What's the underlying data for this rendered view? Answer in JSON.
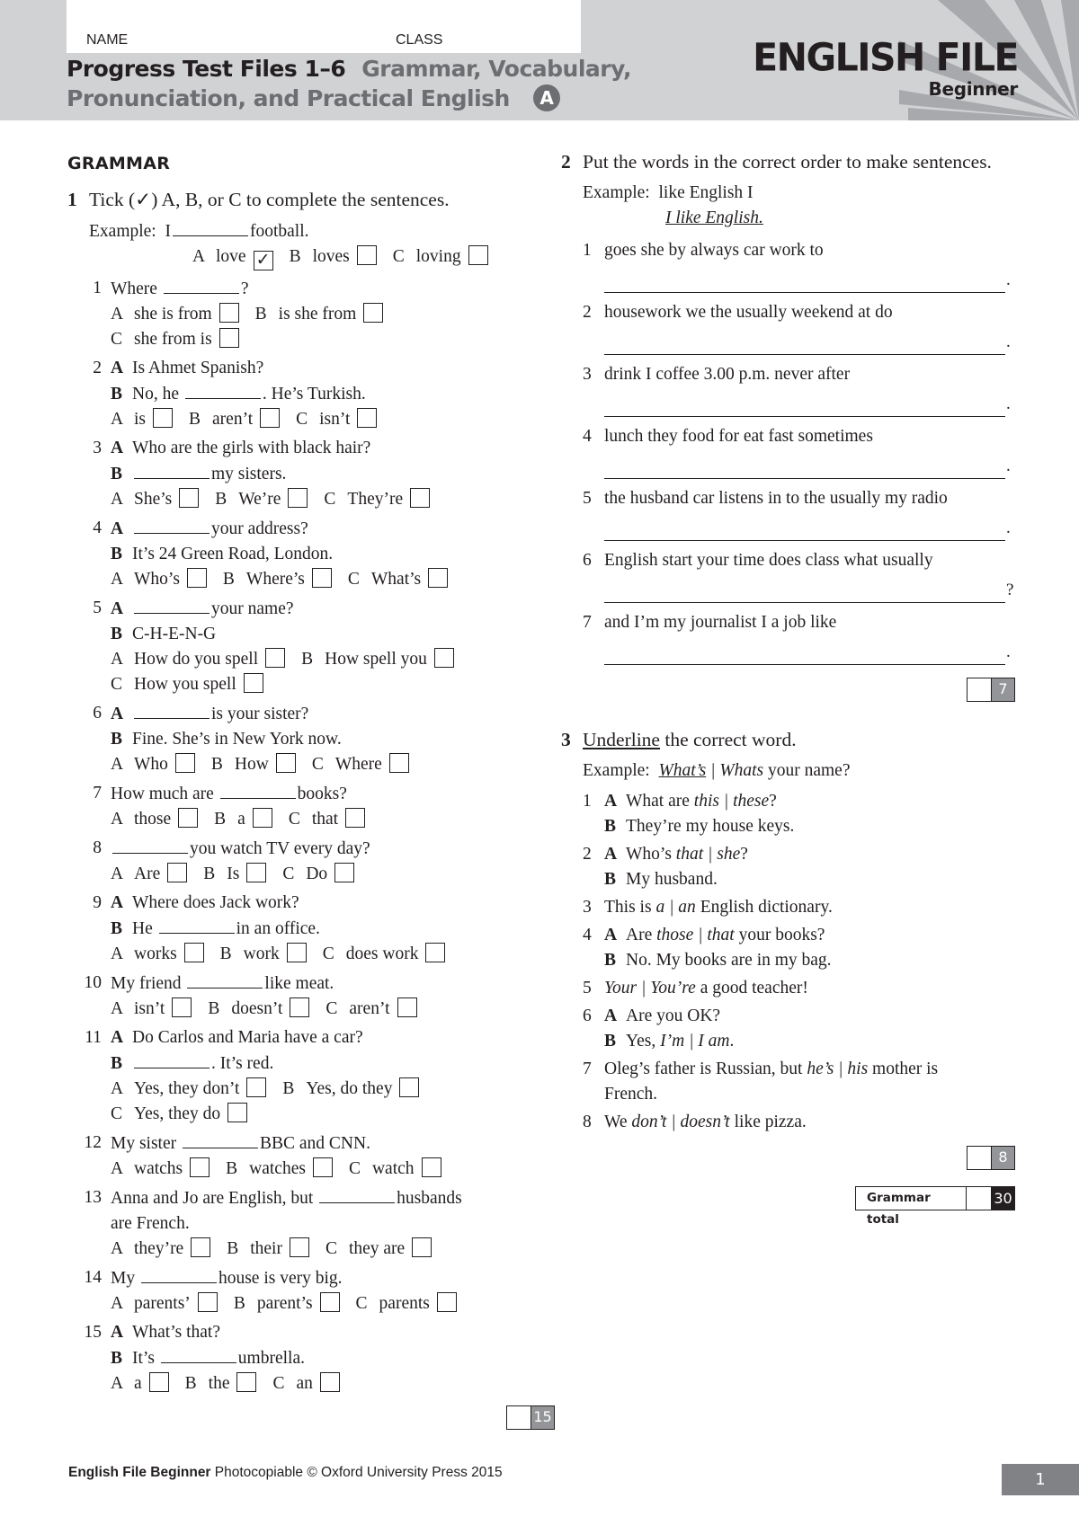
{
  "header": {
    "name_label": "NAME",
    "class_label": "CLASS",
    "title_dark": "Progress Test  Files 1–6",
    "title_grey_1": "Grammar, Vocabulary,",
    "title_grey_2": "Pronunciation, and Practical English",
    "version": "A",
    "brand_title": "ENGLISH FILE",
    "brand_level": "Beginner"
  },
  "grammar": {
    "heading": "GRAMMAR",
    "ex1": {
      "number": "1",
      "instruction": "Tick (✓) A, B, or C to complete the sentences.",
      "example": {
        "label": "Example:",
        "before": "I",
        "after": "football.",
        "options": [
          {
            "letter": "A",
            "text": "love",
            "checked": "✓"
          },
          {
            "letter": "B",
            "text": "loves",
            "checked": ""
          },
          {
            "letter": "C",
            "text": "loving",
            "checked": ""
          }
        ]
      },
      "questions": [
        {
          "num": "1",
          "lines": [
            {
              "spk": "",
              "before": "Where",
              "blank": true,
              "after": "?"
            }
          ],
          "option_rows": [
            [
              {
                "letter": "A",
                "text": "she is from"
              },
              {
                "letter": "B",
                "text": "is she from"
              }
            ],
            [
              {
                "letter": "C",
                "text": "she from is"
              }
            ]
          ]
        },
        {
          "num": "2",
          "lines": [
            {
              "spk": "A",
              "before": "Is Ahmet Spanish?",
              "blank": false,
              "after": ""
            },
            {
              "spk": "B",
              "before": "No, he",
              "blank": true,
              "after": ". He’s Turkish."
            }
          ],
          "option_rows": [
            [
              {
                "letter": "A",
                "text": "is"
              },
              {
                "letter": "B",
                "text": "aren’t"
              },
              {
                "letter": "C",
                "text": "isn’t"
              }
            ]
          ]
        },
        {
          "num": "3",
          "lines": [
            {
              "spk": "A",
              "before": "Who are the girls with black hair?",
              "blank": false,
              "after": ""
            },
            {
              "spk": "B",
              "before": "",
              "blank": true,
              "after": "my sisters."
            }
          ],
          "option_rows": [
            [
              {
                "letter": "A",
                "text": "She’s"
              },
              {
                "letter": "B",
                "text": "We’re"
              },
              {
                "letter": "C",
                "text": "They’re"
              }
            ]
          ]
        },
        {
          "num": "4",
          "lines": [
            {
              "spk": "A",
              "before": "",
              "blank": true,
              "after": "your address?"
            },
            {
              "spk": "B",
              "before": "It’s 24 Green Road, London.",
              "blank": false,
              "after": ""
            }
          ],
          "option_rows": [
            [
              {
                "letter": "A",
                "text": "Who’s"
              },
              {
                "letter": "B",
                "text": "Where’s"
              },
              {
                "letter": "C",
                "text": "What’s"
              }
            ]
          ]
        },
        {
          "num": "5",
          "lines": [
            {
              "spk": "A",
              "before": "",
              "blank": true,
              "after": "your name?"
            },
            {
              "spk": "B",
              "before": "C-H-E-N-G",
              "blank": false,
              "after": ""
            }
          ],
          "option_rows": [
            [
              {
                "letter": "A",
                "text": "How do you spell"
              },
              {
                "letter": "B",
                "text": "How spell you"
              }
            ],
            [
              {
                "letter": "C",
                "text": "How you spell"
              }
            ]
          ]
        },
        {
          "num": "6",
          "lines": [
            {
              "spk": "A",
              "before": "",
              "blank": true,
              "after": "is your sister?"
            },
            {
              "spk": "B",
              "before": "Fine. She’s in New York now.",
              "blank": false,
              "after": ""
            }
          ],
          "option_rows": [
            [
              {
                "letter": "A",
                "text": "Who"
              },
              {
                "letter": "B",
                "text": "How"
              },
              {
                "letter": "C",
                "text": "Where"
              }
            ]
          ]
        },
        {
          "num": "7",
          "lines": [
            {
              "spk": "",
              "before": "How much are",
              "blank": true,
              "after": "books?"
            }
          ],
          "option_rows": [
            [
              {
                "letter": "A",
                "text": "those"
              },
              {
                "letter": "B",
                "text": "a"
              },
              {
                "letter": "C",
                "text": "that"
              }
            ]
          ]
        },
        {
          "num": "8",
          "lines": [
            {
              "spk": "",
              "before": "",
              "blank": true,
              "after": "you watch TV every day?"
            }
          ],
          "option_rows": [
            [
              {
                "letter": "A",
                "text": "Are"
              },
              {
                "letter": "B",
                "text": "Is"
              },
              {
                "letter": "C",
                "text": "Do"
              }
            ]
          ]
        },
        {
          "num": "9",
          "lines": [
            {
              "spk": "A",
              "before": "Where does Jack work?",
              "blank": false,
              "after": ""
            },
            {
              "spk": "B",
              "before": "He",
              "blank": true,
              "after": "in an office."
            }
          ],
          "option_rows": [
            [
              {
                "letter": "A",
                "text": "works"
              },
              {
                "letter": "B",
                "text": "work"
              },
              {
                "letter": "C",
                "text": "does work"
              }
            ]
          ]
        },
        {
          "num": "10",
          "lines": [
            {
              "spk": "",
              "before": "My friend",
              "blank": true,
              "after": "like meat."
            }
          ],
          "option_rows": [
            [
              {
                "letter": "A",
                "text": "isn’t"
              },
              {
                "letter": "B",
                "text": "doesn’t"
              },
              {
                "letter": "C",
                "text": "aren’t"
              }
            ]
          ]
        },
        {
          "num": "11",
          "lines": [
            {
              "spk": "A",
              "before": "Do Carlos and Maria have a car?",
              "blank": false,
              "after": ""
            },
            {
              "spk": "B",
              "before": "",
              "blank": true,
              "after": ". It’s red."
            }
          ],
          "option_rows": [
            [
              {
                "letter": "A",
                "text": "Yes, they don’t"
              },
              {
                "letter": "B",
                "text": "Yes, do they"
              }
            ],
            [
              {
                "letter": "C",
                "text": "Yes, they do"
              }
            ]
          ]
        },
        {
          "num": "12",
          "lines": [
            {
              "spk": "",
              "before": "My sister",
              "blank": true,
              "after": "BBC and CNN."
            }
          ],
          "option_rows": [
            [
              {
                "letter": "A",
                "text": "watchs"
              },
              {
                "letter": "B",
                "text": "watches"
              },
              {
                "letter": "C",
                "text": "watch"
              }
            ]
          ]
        },
        {
          "num": "13",
          "lines": [
            {
              "spk": "",
              "before": "Anna and Jo are English, but",
              "blank": true,
              "after": "husbands"
            },
            {
              "spk": "",
              "before": "are French.",
              "blank": false,
              "after": ""
            }
          ],
          "option_rows": [
            [
              {
                "letter": "A",
                "text": "they’re"
              },
              {
                "letter": "B",
                "text": "their"
              },
              {
                "letter": "C",
                "text": "they are"
              }
            ]
          ]
        },
        {
          "num": "14",
          "lines": [
            {
              "spk": "",
              "before": "My",
              "blank": true,
              "after": "house is very big."
            }
          ],
          "option_rows": [
            [
              {
                "letter": "A",
                "text": "parents’"
              },
              {
                "letter": "B",
                "text": "parent’s"
              },
              {
                "letter": "C",
                "text": "parents"
              }
            ]
          ]
        },
        {
          "num": "15",
          "lines": [
            {
              "spk": "A",
              "before": "What’s that?",
              "blank": false,
              "after": ""
            },
            {
              "spk": "B",
              "before": "It’s",
              "blank": true,
              "after": "umbrella."
            }
          ],
          "option_rows": [
            [
              {
                "letter": "A",
                "text": "a"
              },
              {
                "letter": "B",
                "text": "the"
              },
              {
                "letter": "C",
                "text": "an"
              }
            ]
          ]
        }
      ],
      "score_max": "15"
    },
    "ex2": {
      "number": "2",
      "instruction": "Put the words in the correct order to make sentences.",
      "example": {
        "label": "Example:",
        "words": "like English I",
        "answer": "I like English."
      },
      "questions": [
        {
          "num": "1",
          "words": "goes she by always car work to",
          "end": "."
        },
        {
          "num": "2",
          "words": "housework we the usually weekend at do",
          "end": "."
        },
        {
          "num": "3",
          "words": "drink I coffee 3.00 p.m. never after",
          "end": "."
        },
        {
          "num": "4",
          "words": "lunch they food for eat fast sometimes",
          "end": "."
        },
        {
          "num": "5",
          "words": "the husband car listens in to the usually my radio",
          "end": "."
        },
        {
          "num": "6",
          "words": "English start your time does class what usually",
          "end": "?"
        },
        {
          "num": "7",
          "words": "and I’m my journalist I a job like",
          "end": "."
        }
      ],
      "score_max": "7"
    },
    "ex3": {
      "number": "3",
      "instruction_underlined": "Underline",
      "instruction_rest": " the correct word.",
      "example": {
        "label": "Example:",
        "choice1": "What’s",
        "sep": " | ",
        "choice2": "Whats",
        "after": " your name?"
      },
      "questions": [
        {
          "num": "1",
          "lines": [
            {
              "spk": "A",
              "parts": [
                {
                  "t": "What are ",
                  "i": false
                },
                {
                  "t": "this | these",
                  "i": true
                },
                {
                  "t": "?",
                  "i": false
                }
              ]
            },
            {
              "spk": "B",
              "parts": [
                {
                  "t": "They’re my house keys.",
                  "i": false
                }
              ]
            }
          ]
        },
        {
          "num": "2",
          "lines": [
            {
              "spk": "A",
              "parts": [
                {
                  "t": "Who’s ",
                  "i": false
                },
                {
                  "t": "that | she",
                  "i": true
                },
                {
                  "t": "?",
                  "i": false
                }
              ]
            },
            {
              "spk": "B",
              "parts": [
                {
                  "t": "My husband.",
                  "i": false
                }
              ]
            }
          ]
        },
        {
          "num": "3",
          "lines": [
            {
              "spk": "",
              "parts": [
                {
                  "t": "This is ",
                  "i": false
                },
                {
                  "t": "a | an",
                  "i": true
                },
                {
                  "t": " English dictionary.",
                  "i": false
                }
              ]
            }
          ]
        },
        {
          "num": "4",
          "lines": [
            {
              "spk": "A",
              "parts": [
                {
                  "t": "Are ",
                  "i": false
                },
                {
                  "t": "those | that",
                  "i": true
                },
                {
                  "t": " your books?",
                  "i": false
                }
              ]
            },
            {
              "spk": "B",
              "parts": [
                {
                  "t": "No. My books are in my bag.",
                  "i": false
                }
              ]
            }
          ]
        },
        {
          "num": "5",
          "lines": [
            {
              "spk": "",
              "parts": [
                {
                  "t": "Your | You’re",
                  "i": true
                },
                {
                  "t": " a good teacher!",
                  "i": false
                }
              ]
            }
          ]
        },
        {
          "num": "6",
          "lines": [
            {
              "spk": "A",
              "parts": [
                {
                  "t": "Are you OK?",
                  "i": false
                }
              ]
            },
            {
              "spk": "B",
              "parts": [
                {
                  "t": "Yes, ",
                  "i": false
                },
                {
                  "t": "I’m | I am",
                  "i": true
                },
                {
                  "t": ".",
                  "i": false
                }
              ]
            }
          ]
        },
        {
          "num": "7",
          "lines": [
            {
              "spk": "",
              "parts": [
                {
                  "t": "Oleg’s father is Russian, but ",
                  "i": false
                },
                {
                  "t": "he’s | his",
                  "i": true
                },
                {
                  "t": " mother is",
                  "i": false
                }
              ]
            },
            {
              "spk": "",
              "parts": [
                {
                  "t": "French.",
                  "i": false
                }
              ]
            }
          ]
        },
        {
          "num": "8",
          "lines": [
            {
              "spk": "",
              "parts": [
                {
                  "t": "We ",
                  "i": false
                },
                {
                  "t": "don’t | doesn’t",
                  "i": true
                },
                {
                  "t": " like pizza.",
                  "i": false
                }
              ]
            }
          ]
        }
      ],
      "score_max": "8"
    },
    "total_label": "Grammar total",
    "total_max": "30"
  },
  "footer": {
    "brand": "English File Beginner",
    "rest": " Photocopiable © Oxford University Press 2015",
    "page_number": "1"
  }
}
